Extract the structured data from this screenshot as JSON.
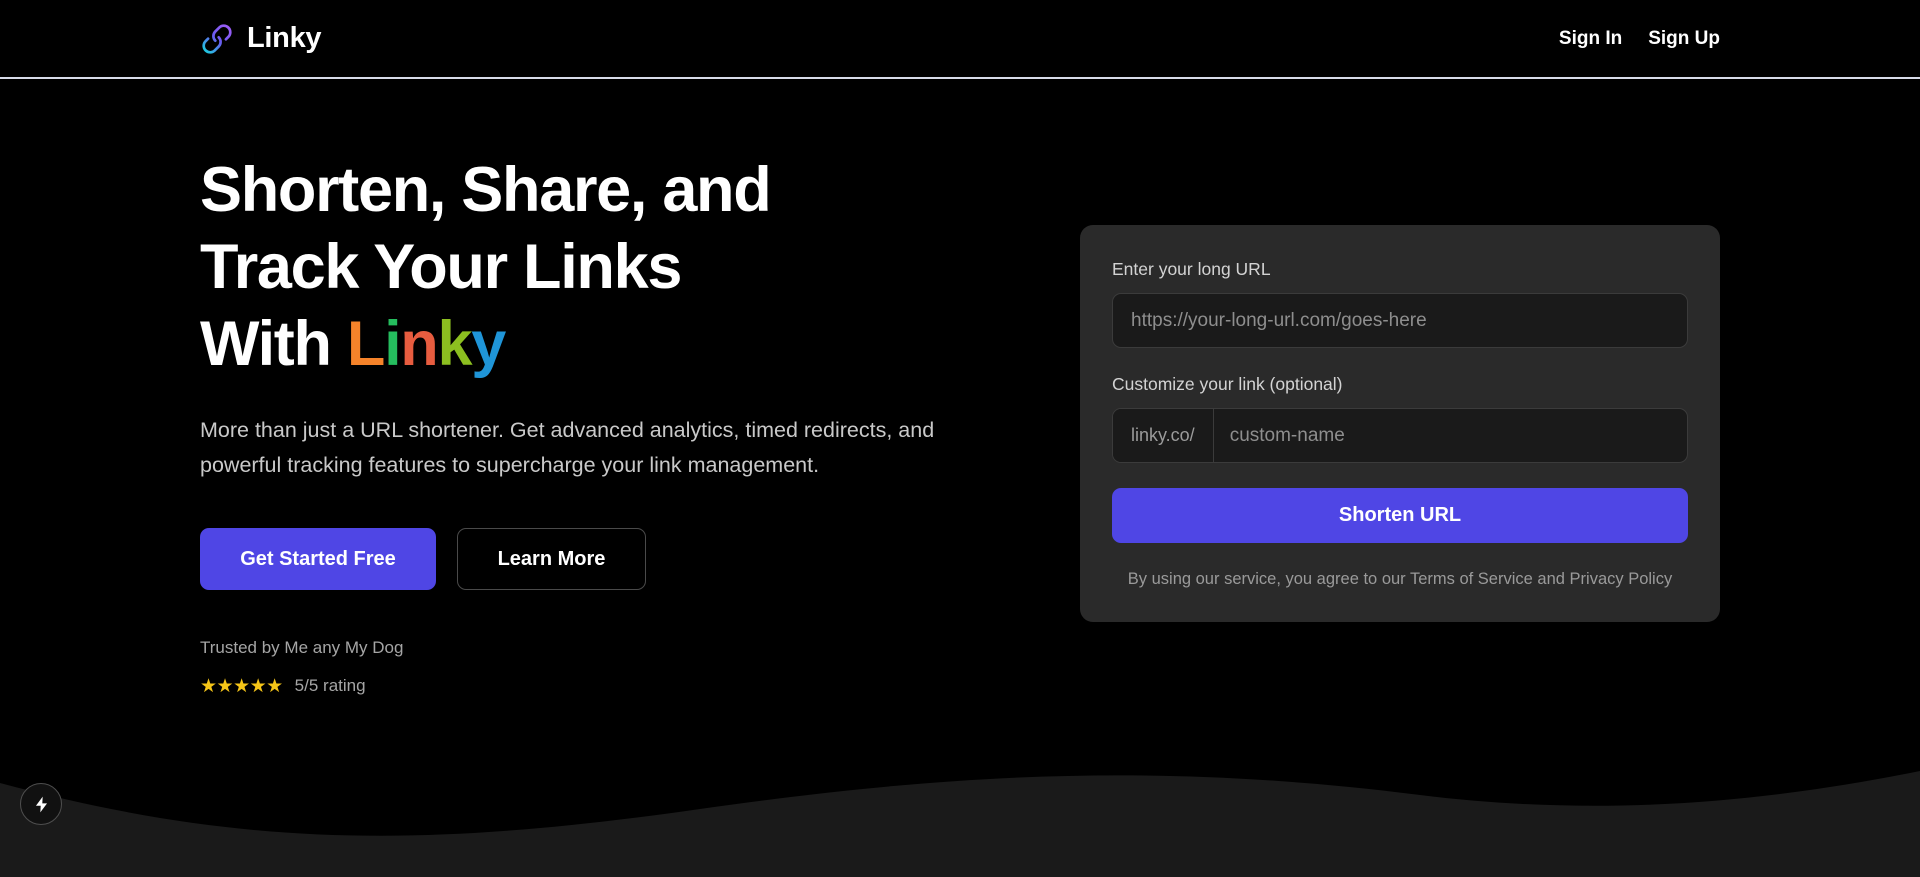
{
  "header": {
    "logo_icon": "link-chain-icon",
    "brand_name": "Linky",
    "nav": [
      {
        "label": "Sign In",
        "name": "sign-in"
      },
      {
        "label": "Sign Up",
        "name": "sign-up"
      }
    ]
  },
  "hero": {
    "headline_line1": "Shorten, Share, and",
    "headline_line2": "Track Your Links",
    "headline_line3_prefix": "With ",
    "brand_letters": [
      {
        "char": "L",
        "color": "#f5832a"
      },
      {
        "char": "i",
        "color": "#25bd5e"
      },
      {
        "char": "n",
        "color": "#e75c3f"
      },
      {
        "char": "k",
        "color": "#8cbf20"
      },
      {
        "char": "y",
        "color": "#1f95d8"
      }
    ],
    "subheadline": "More than just a URL shortener. Get advanced analytics, timed redirects, and powerful tracking features to supercharge your link management.",
    "primary_cta": "Get Started Free",
    "secondary_cta": "Learn More",
    "trusted_by": "Trusted by Me any My Dog",
    "stars": "★★★★★",
    "stars_color": "#f5c518",
    "rating_text": "5/5 rating"
  },
  "form": {
    "url_label": "Enter your long URL",
    "url_placeholder": "https://your-long-url.com/goes-here",
    "url_value": "",
    "custom_label": "Customize your link (optional)",
    "custom_prefix": "linky.co/",
    "custom_placeholder": "custom-name",
    "custom_value": "",
    "submit_label": "Shorten URL",
    "terms_prefix": "By using our service, you agree to our ",
    "terms_link": "Terms of Service",
    "terms_middle": " and ",
    "privacy_link": "Privacy Policy"
  },
  "footer": {
    "fab_icon": "lightning-bolt-icon"
  },
  "theme": {
    "background": "#000000",
    "accent": "#4f46e5",
    "card_bg": "#2a2a2a",
    "input_bg": "#1a1a1a",
    "wave_fill": "#1a1a1a",
    "header_border": "#d7dbe8"
  }
}
